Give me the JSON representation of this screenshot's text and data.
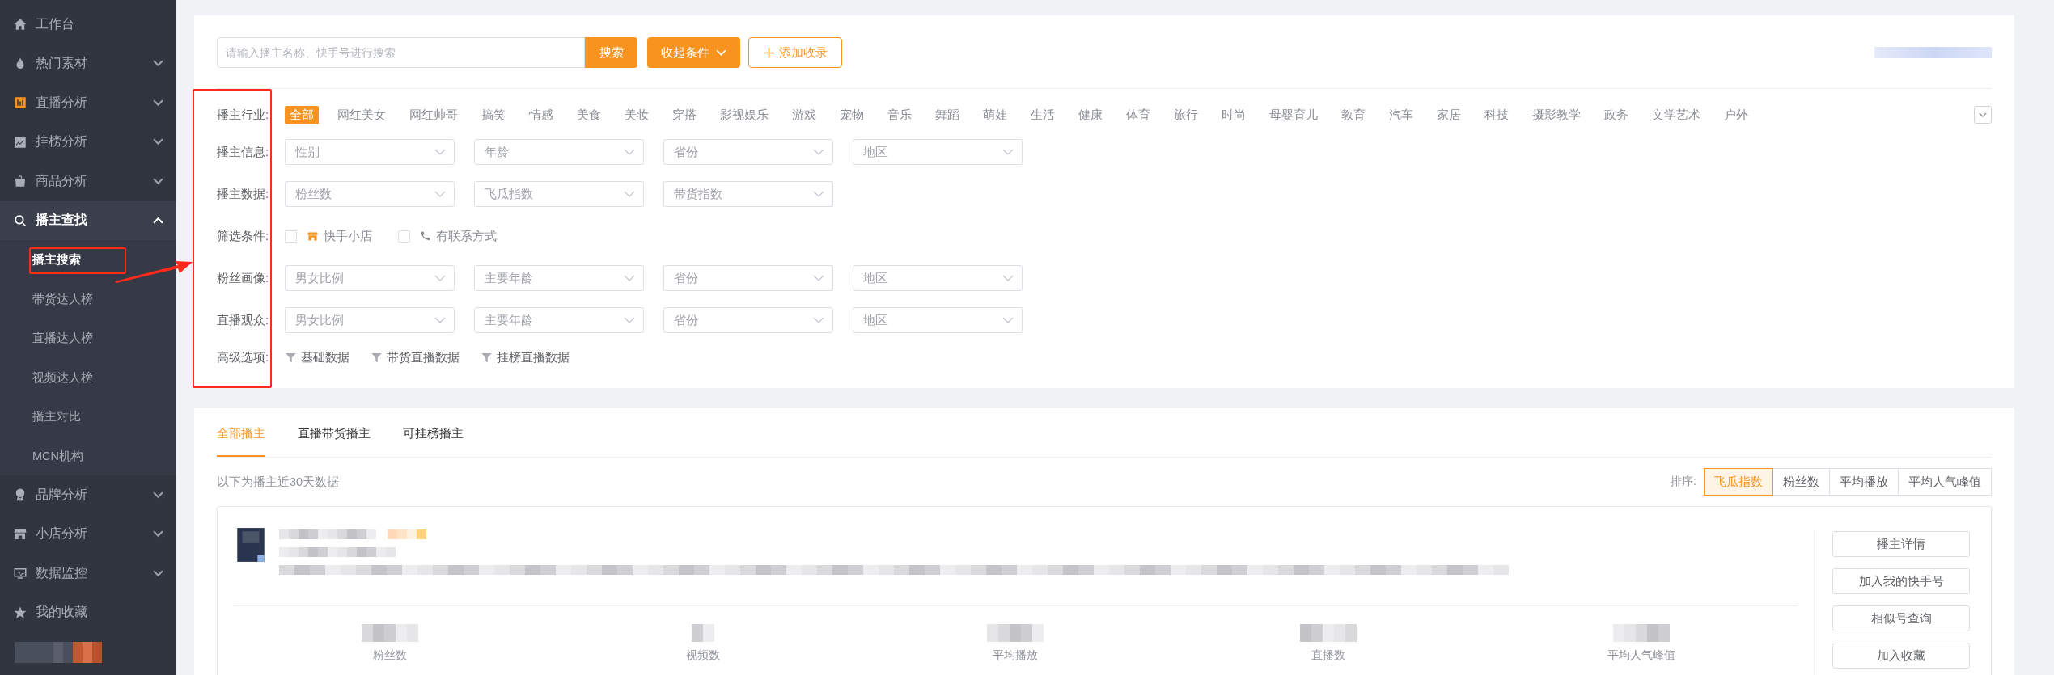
{
  "sidebar": {
    "items": [
      {
        "label": "工作台",
        "kind": "link"
      },
      {
        "label": "热门素材",
        "kind": "group",
        "expanded": false
      },
      {
        "label": "直播分析",
        "kind": "group",
        "expanded": false
      },
      {
        "label": "挂榜分析",
        "kind": "group",
        "expanded": false
      },
      {
        "label": "商品分析",
        "kind": "group",
        "expanded": false
      },
      {
        "label": "播主查找",
        "kind": "group",
        "expanded": true,
        "children": [
          {
            "label": "播主搜索",
            "selected": true
          },
          {
            "label": "带货达人榜",
            "selected": false
          },
          {
            "label": "直播达人榜",
            "selected": false
          },
          {
            "label": "视频达人榜",
            "selected": false
          },
          {
            "label": "播主对比",
            "selected": false
          },
          {
            "label": "MCN机构",
            "selected": false
          }
        ]
      },
      {
        "label": "品牌分析",
        "kind": "group",
        "expanded": false
      },
      {
        "label": "小店分析",
        "kind": "group",
        "expanded": false
      },
      {
        "label": "数据监控",
        "kind": "group",
        "expanded": false
      },
      {
        "label": "我的收藏",
        "kind": "link"
      }
    ]
  },
  "search": {
    "placeholder": "请输入播主名称、快手号进行搜索",
    "button": "搜索",
    "collapse_button": "收起条件",
    "add_button": "添加收录"
  },
  "filters": [
    {
      "label": "播主行业:",
      "kind": "tags",
      "items": [
        {
          "label": "全部",
          "selected": true
        },
        {
          "label": "网红美女",
          "selected": false
        },
        {
          "label": "网红帅哥",
          "selected": false
        },
        {
          "label": "搞笑",
          "selected": false
        },
        {
          "label": "情感",
          "selected": false
        },
        {
          "label": "美食",
          "selected": false
        },
        {
          "label": "美妆",
          "selected": false
        },
        {
          "label": "穿搭",
          "selected": false
        },
        {
          "label": "影视娱乐",
          "selected": false
        },
        {
          "label": "游戏",
          "selected": false
        },
        {
          "label": "宠物",
          "selected": false
        },
        {
          "label": "音乐",
          "selected": false
        },
        {
          "label": "舞蹈",
          "selected": false
        },
        {
          "label": "萌娃",
          "selected": false
        },
        {
          "label": "生活",
          "selected": false
        },
        {
          "label": "健康",
          "selected": false
        },
        {
          "label": "体育",
          "selected": false
        },
        {
          "label": "旅行",
          "selected": false
        },
        {
          "label": "时尚",
          "selected": false
        },
        {
          "label": "母婴育儿",
          "selected": false
        },
        {
          "label": "教育",
          "selected": false
        },
        {
          "label": "汽车",
          "selected": false
        },
        {
          "label": "家居",
          "selected": false
        },
        {
          "label": "科技",
          "selected": false
        },
        {
          "label": "摄影教学",
          "selected": false
        },
        {
          "label": "政务",
          "selected": false
        },
        {
          "label": "文学艺术",
          "selected": false
        },
        {
          "label": "户外",
          "selected": false
        }
      ]
    },
    {
      "label": "播主信息:",
      "kind": "selects",
      "items": [
        "性别",
        "年龄",
        "省份",
        "地区"
      ]
    },
    {
      "label": "播主数据:",
      "kind": "selects",
      "items": [
        "粉丝数",
        "飞瓜指数",
        "带货指数"
      ]
    },
    {
      "label": "筛选条件:",
      "kind": "checks",
      "items": [
        {
          "label": "快手小店",
          "checked": false
        },
        {
          "label": "有联系方式",
          "checked": false
        }
      ]
    },
    {
      "label": "粉丝画像:",
      "kind": "selects",
      "items": [
        "男女比例",
        "主要年龄",
        "省份",
        "地区"
      ]
    },
    {
      "label": "直播观众:",
      "kind": "selects",
      "items": [
        "男女比例",
        "主要年龄",
        "省份",
        "地区"
      ]
    },
    {
      "label": "高级选项:",
      "kind": "options",
      "items": [
        "基础数据",
        "带货直播数据",
        "挂榜直播数据"
      ]
    }
  ],
  "results": {
    "tabs": [
      {
        "label": "全部播主",
        "selected": true
      },
      {
        "label": "直播带货播主",
        "selected": false
      },
      {
        "label": "可挂榜播主",
        "selected": false
      }
    ],
    "note": "以下为播主近30天数据",
    "sort_label": "排序:",
    "sort_options": [
      {
        "label": "飞瓜指数",
        "selected": true
      },
      {
        "label": "粉丝数",
        "selected": false
      },
      {
        "label": "平均播放",
        "selected": false
      },
      {
        "label": "平均人气峰值",
        "selected": false
      }
    ],
    "card": {
      "stats": [
        "粉丝数",
        "视频数",
        "平均播放",
        "直播数",
        "平均人气峰值"
      ],
      "actions": [
        "播主详情",
        "加入我的快手号",
        "相似号查询",
        "加入收藏"
      ]
    }
  }
}
